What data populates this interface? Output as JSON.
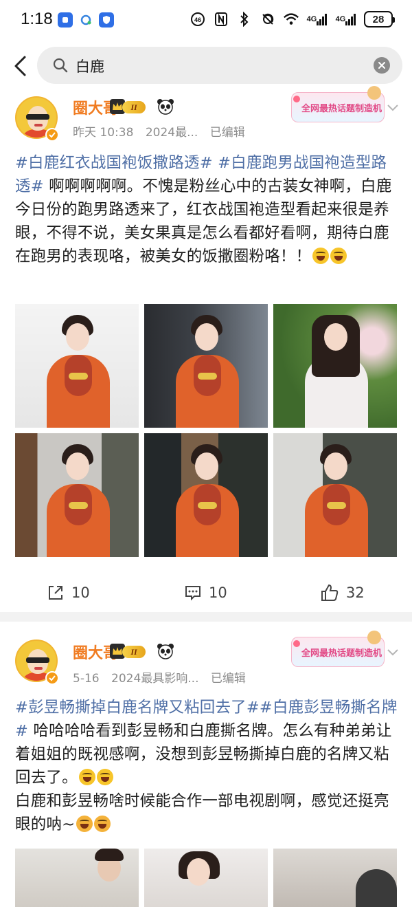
{
  "status_bar": {
    "time": "1:18",
    "network_4g_a": "4G",
    "network_4g_b": "4G",
    "battery": "28"
  },
  "search": {
    "query": "白鹿"
  },
  "posts": [
    {
      "username": "圈大哥",
      "level": "II",
      "time": "昨天 10:38",
      "source": "2024最...",
      "edited": "已编辑",
      "topic_banner": "全网最热话题制造机",
      "text": {
        "tag1": "#白鹿红衣战国袍饭撒路透#",
        "tag2": "#白鹿跑男战国袍造型路透#",
        "body": " 啊啊啊啊啊。不愧是粉丝心中的古装女神啊，白鹿今日份的跑男路透来了，红衣战国袍造型看起来很是养眼，不得不说，美女果真是怎么看都好看啊，期待白鹿在跑男的表现咯，被美女的饭撒圈粉咯！！"
      },
      "images": [
        {
          "label": "photo-1",
          "scene": "studio-white"
        },
        {
          "label": "photo-2",
          "scene": "street-crowd"
        },
        {
          "label": "photo-3",
          "scene": "flowers"
        },
        {
          "label": "photo-4",
          "scene": "building"
        },
        {
          "label": "photo-5",
          "scene": "building"
        },
        {
          "label": "photo-6",
          "scene": "building"
        }
      ],
      "actions": {
        "repost": "10",
        "comment": "10",
        "like": "32"
      }
    },
    {
      "username": "圈大哥",
      "level": "II",
      "time": "5-16",
      "source": "2024最具影响...",
      "edited": "已编辑",
      "topic_banner": "全网最热话题制造机",
      "text": {
        "tag1": "#彭昱畅撕掉白鹿名牌又粘回去了#",
        "tag2": "#白鹿彭昱畅撕名牌#",
        "body1": " 哈哈哈哈看到彭昱畅和白鹿撕名牌。怎么有种弟弟让着姐姐的既视感啊，没想到彭昱畅撕掉白鹿的名牌又粘回去了。",
        "body2": "白鹿和彭昱畅啥时候能合作一部电视剧啊，感觉还挺亮眼的呐~"
      }
    }
  ],
  "colors": {
    "username": "#f07c22",
    "hashtag": "#4f6fa6",
    "meta": "#8c8c8c"
  }
}
